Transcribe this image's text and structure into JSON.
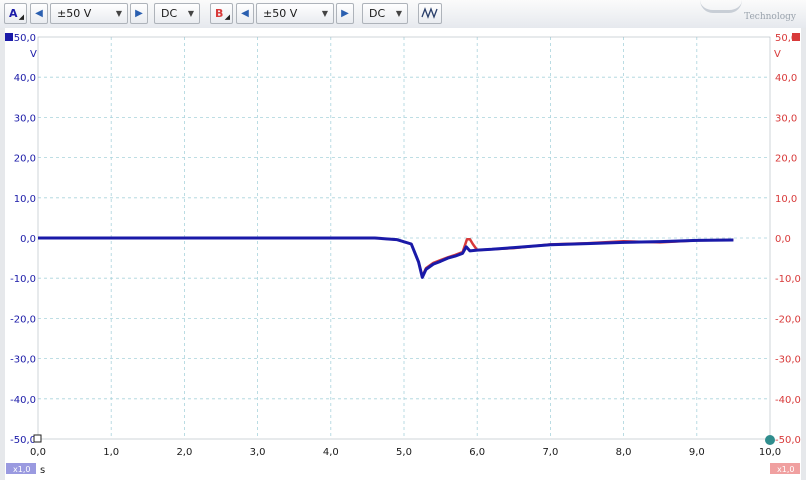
{
  "toolbar": {
    "channel_a": {
      "label": "A",
      "range": "±50 V",
      "coupling": "DC"
    },
    "channel_b": {
      "label": "B",
      "range": "±50 V",
      "coupling": "DC"
    },
    "logo_text": "Technology",
    "colors": {
      "channel_a": "#1a1aa8",
      "channel_b": "#d83a3a",
      "accent_buttons": "#2a5fb0"
    },
    "icons": [
      "chevron-left-icon",
      "chevron-right-icon",
      "dropdown-arrow-icon",
      "waveform-icon"
    ]
  },
  "chart_data": {
    "type": "line",
    "x_unit": "s",
    "y_unit_left": "V",
    "y_unit_right": "V",
    "xlim": [
      0,
      10
    ],
    "ylim": [
      -50,
      50
    ],
    "grid": true,
    "x_ticks": [
      "0,0",
      "1,0",
      "2,0",
      "3,0",
      "4,0",
      "5,0",
      "6,0",
      "7,0",
      "8,0",
      "9,0",
      "10,0"
    ],
    "y_ticks": [
      "50,0",
      "40,0",
      "30,0",
      "20,0",
      "10,0",
      "0,0",
      "-10,0",
      "-20,0",
      "-30,0",
      "-40,0",
      "-50,0"
    ],
    "scale_label_left": "x1,0",
    "scale_label_right": "x1,0",
    "series": [
      {
        "color": "#d83a3a",
        "x": [
          0,
          1,
          2,
          3,
          4,
          4.6,
          4.9,
          5.1,
          5.2,
          5.25,
          5.3,
          5.4,
          5.5,
          5.6,
          5.7,
          5.8,
          5.86,
          5.9,
          5.94,
          6.0,
          6.2,
          6.5,
          7.0,
          7.5,
          8.0,
          8.5,
          9.0,
          9.5
        ],
        "y": [
          0,
          0,
          0,
          0,
          0,
          0,
          -0.4,
          -1.5,
          -6,
          -9.5,
          -7.5,
          -6.2,
          -5.5,
          -4.8,
          -4.2,
          -3.5,
          -0.3,
          -0.3,
          -1.5,
          -3,
          -2.8,
          -2.5,
          -1.6,
          -1.3,
          -0.8,
          -1.1,
          -0.6,
          -0.5
        ]
      },
      {
        "color": "#1a1aa8",
        "x": [
          0,
          1,
          2,
          3,
          4,
          4.6,
          4.9,
          5.1,
          5.2,
          5.25,
          5.3,
          5.4,
          5.5,
          5.6,
          5.7,
          5.8,
          5.85,
          5.9,
          6.0,
          6.2,
          6.5,
          7.0,
          7.5,
          8.0,
          8.5,
          9.0,
          9.5
        ],
        "y": [
          0,
          0,
          0,
          0,
          0,
          0,
          -0.4,
          -1.5,
          -6,
          -9.8,
          -7.8,
          -6.5,
          -5.8,
          -5.0,
          -4.5,
          -3.8,
          -2.2,
          -3.2,
          -3.0,
          -2.8,
          -2.4,
          -1.7,
          -1.4,
          -1.1,
          -0.9,
          -0.6,
          -0.5
        ]
      }
    ]
  }
}
